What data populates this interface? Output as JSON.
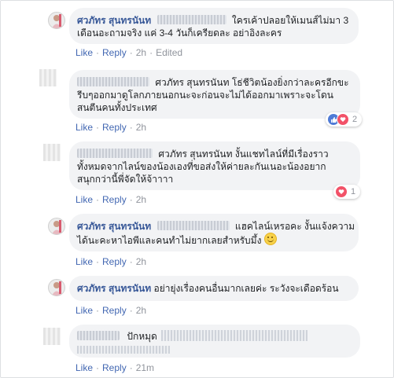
{
  "comments": [
    {
      "author": "ศวภัทร สุนทรนันท",
      "text_line1": "ใครเค้าปลอยให้เมนส์ไม่มา 3",
      "text_line2": "เดือนอะถามจริง แค่ 3-4 วันก็เครียดละ อย่าอิงละคร",
      "like": "Like",
      "reply": "Reply",
      "time": "2h",
      "edited": "Edited"
    },
    {
      "author": "ศวภัทร สุนทรนันท",
      "text_line1": "โธ่ชีวิตน้องยิ่งกว่าละครอีกขะ",
      "text_line2": "รีบๆออกมาดูโลกภายนอกนะจะก่อนจะไม่ได้ออกมาเพราะจะโดน",
      "text_line3": "สนตีนคนทั้งประเทศ",
      "like": "Like",
      "reply": "Reply",
      "time": "2h",
      "reaction_count": "2"
    },
    {
      "author": "ศวภัทร สุนทรนันท",
      "text_line1": "งั้นแชทไลน์ที่มีเรื่องราว",
      "text_line2": "ทั้งหมดจากไลน์ของน้องเองที่ขอส่งให้ค่ายละกันเนอะน้องอยาก",
      "text_line3": "สนุกกว่านี้พี่จัดให้จ้าาาา",
      "like": "Like",
      "reply": "Reply",
      "time": "2h",
      "reaction_count": "1"
    },
    {
      "author": "ศวภัทร สุนทรนันท",
      "text_line1": "แฮคไลน์เหรอคะ งั้นแจ้งความ",
      "text_line2": "ได้นะคะหาไอพีและคนทำไม่ยากเลยสำหรับมึ้ง",
      "like": "Like",
      "reply": "Reply",
      "time": "2h"
    },
    {
      "author": "ศวภัทร สุนทรนันท",
      "text_line1": "อย่ายุ่งเรื่องคนอื่นมากเลยค่ะ ระวังจะเดือดร้อน",
      "like": "Like",
      "reply": "Reply",
      "time": "2h"
    },
    {
      "text_line1": "ปักหมุด",
      "like": "Like",
      "reply": "Reply",
      "time": "21m"
    }
  ],
  "icons": {
    "like": "like-icon",
    "love": "love-icon",
    "smile": "smile-emoji-icon"
  },
  "colors": {
    "link": "#4267b2",
    "author": "#385898",
    "bubble": "#f2f3f5",
    "meta": "#90949c"
  }
}
